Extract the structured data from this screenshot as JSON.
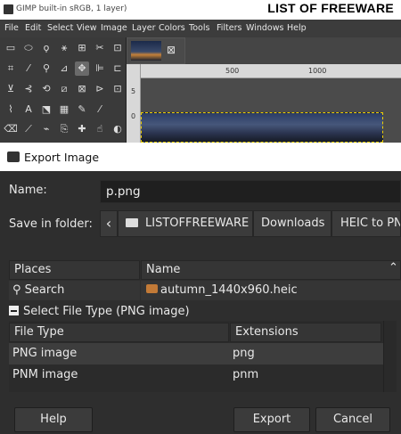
{
  "brand_text": "LIST OF FREEWARE",
  "gimp": {
    "title": "GIMP built-in sRGB, 1 layer)",
    "menu": [
      "File",
      "Edit",
      "Select",
      "View",
      "Image",
      "Layer",
      "Colors",
      "Tools",
      "Filters",
      "Windows",
      "Help"
    ],
    "ruler_ticks": [
      "500",
      "1000"
    ],
    "ruler_v_tick": "0",
    "ruler_v_tick2": "5"
  },
  "dialog": {
    "title": "Export Image",
    "name_label": "Name:",
    "name_value": "p.png",
    "folder_label": "Save in folder:",
    "crumbs": [
      "LISTOFFREEWARE",
      "Downloads",
      "HEIC to PN"
    ],
    "places_header": "Places",
    "name_header": "Name",
    "search_label": "Search",
    "file_name": "autumn_1440x960.heic",
    "file_type_toggle": "Select File Type (PNG image)",
    "table": {
      "headers": [
        "File Type",
        "Extensions"
      ],
      "rows": [
        {
          "type": "PNG image",
          "ext": "png"
        },
        {
          "type": "PNM image",
          "ext": "pnm"
        }
      ]
    },
    "buttons": {
      "help": "Help",
      "export": "Export",
      "cancel": "Cancel"
    }
  },
  "colors": {
    "dialog_bg": "#2e2e2e",
    "selection_marquee": "#f0d000"
  }
}
